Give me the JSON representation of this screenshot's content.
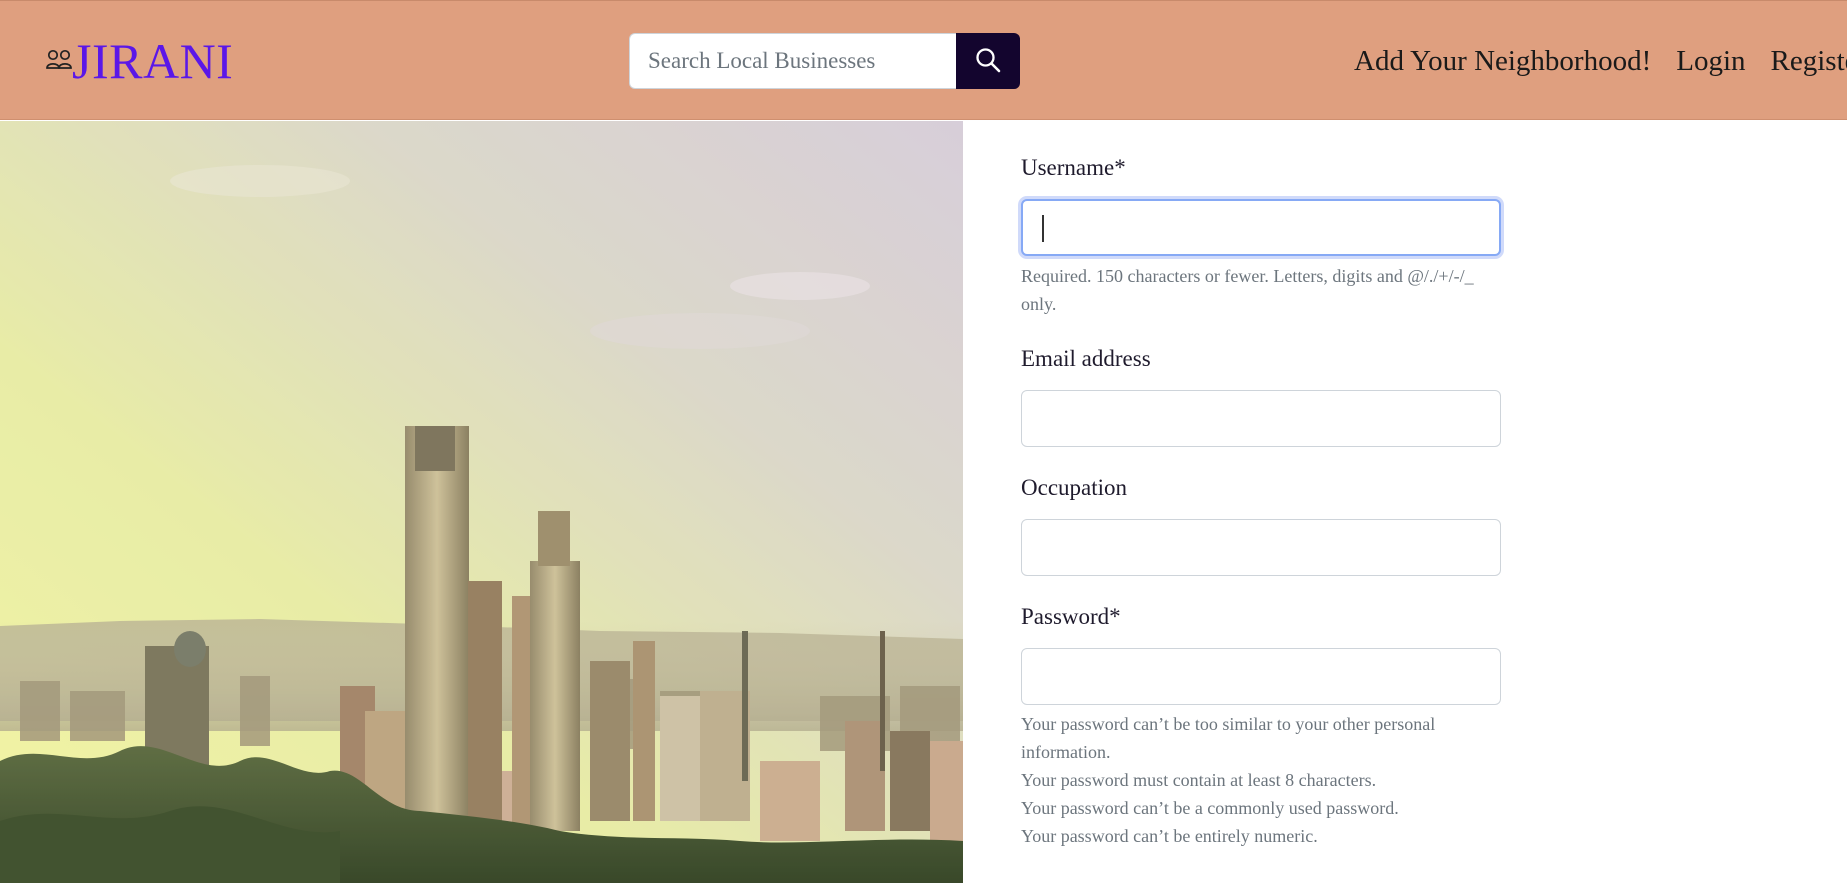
{
  "navbar": {
    "brand_icon": "people-icon",
    "brand": "JIRANI",
    "search_placeholder": "Search Local Businesses",
    "search_icon": "search-icon",
    "links": {
      "add_neighborhood": "Add Your Neighborhood!",
      "login": "Login",
      "register": "Register"
    }
  },
  "hero": {
    "image": "city-skyline-photo"
  },
  "form": {
    "username": {
      "label": "Username*",
      "value": "",
      "help": "Required. 150 characters or fewer. Letters, digits and @/./+/-/_ only."
    },
    "email": {
      "label": "Email address",
      "value": ""
    },
    "occupation": {
      "label": "Occupation",
      "value": ""
    },
    "password": {
      "label": "Password*",
      "value": "",
      "help": [
        "Your password can’t be too similar to your other personal information.",
        "Your password must contain at least 8 characters.",
        "Your password can’t be a commonly used password.",
        "Your password can’t be entirely numeric."
      ]
    }
  },
  "colors": {
    "navbar_bg": "#df9f7f",
    "brand": "#5a17e8",
    "search_button": "#13052e",
    "focus_ring": "#86a9f5"
  }
}
